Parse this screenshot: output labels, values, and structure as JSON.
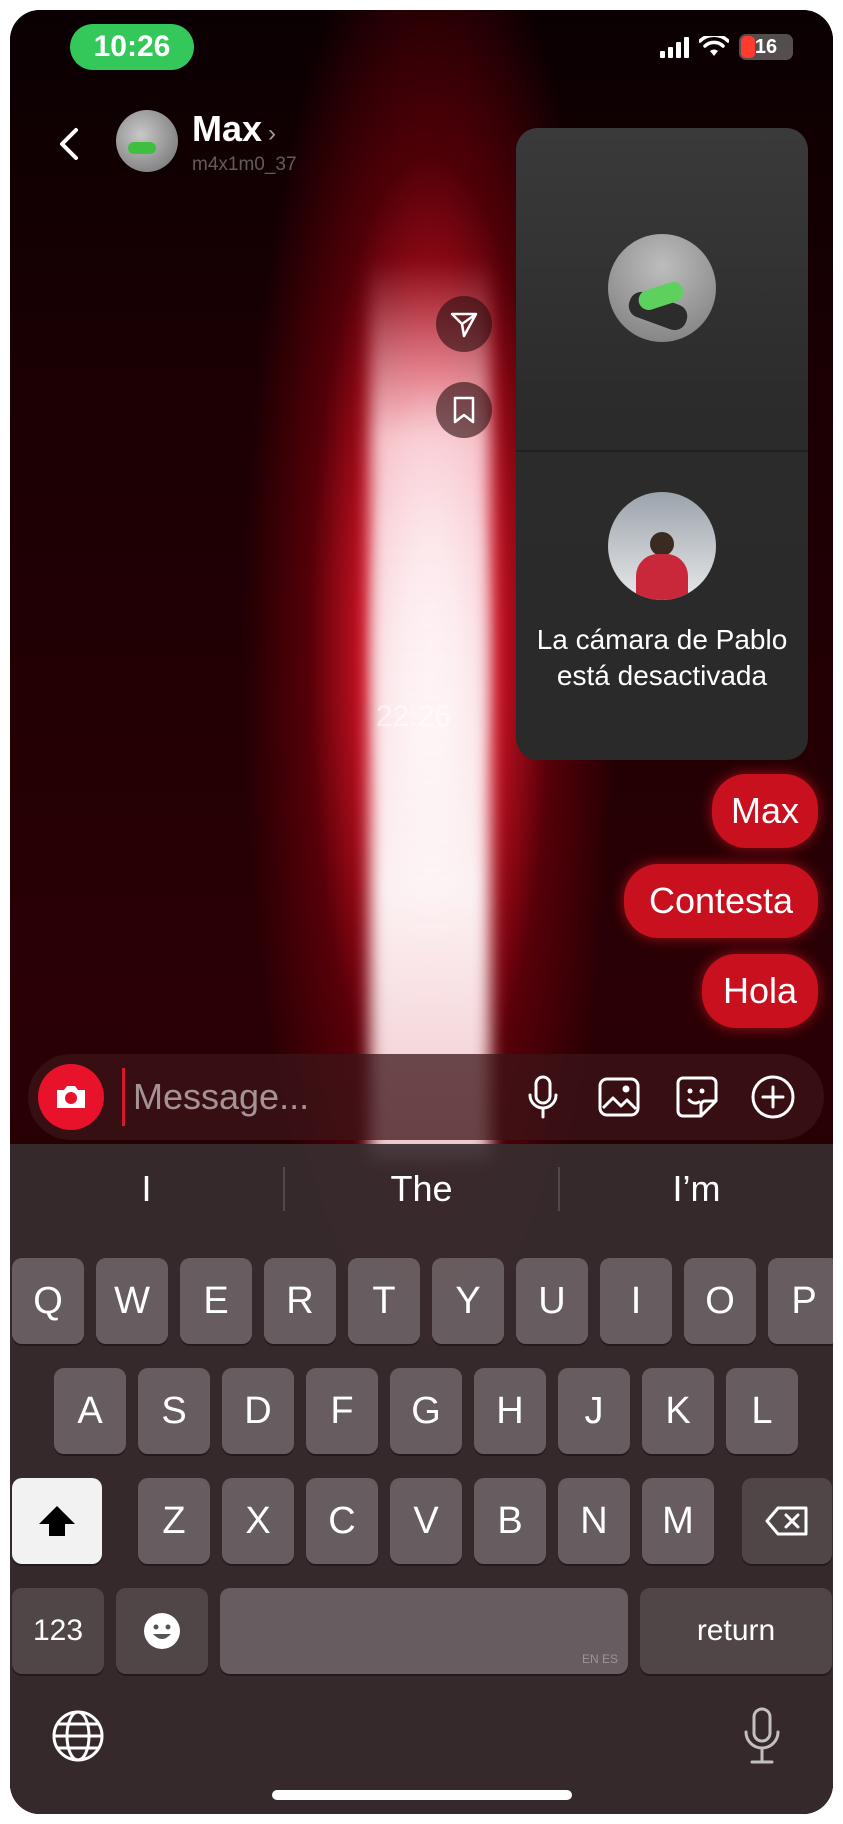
{
  "status_bar": {
    "time": "10:26",
    "battery": "16"
  },
  "header": {
    "contact_name": "Max",
    "username": "m4x1m0_37"
  },
  "chat": {
    "timestamp": "22:26",
    "messages": [
      {
        "text": "Max"
      },
      {
        "text": "Contesta"
      },
      {
        "text": "Hola"
      }
    ]
  },
  "call_panel": {
    "camera_off_text": "La cámara de Pablo está desactivada"
  },
  "composer": {
    "placeholder": "Message..."
  },
  "keyboard": {
    "suggestions": [
      "I",
      "The",
      "I’m"
    ],
    "row1": [
      "Q",
      "W",
      "E",
      "R",
      "T",
      "Y",
      "U",
      "I",
      "O",
      "P"
    ],
    "row2": [
      "A",
      "S",
      "D",
      "F",
      "G",
      "H",
      "J",
      "K",
      "L"
    ],
    "row3": [
      "Z",
      "X",
      "C",
      "V",
      "B",
      "N",
      "M"
    ],
    "numbers_key": "123",
    "return_key": "return",
    "space_hint": "EN ES"
  },
  "colors": {
    "accent": "#c8101e",
    "time_pill": "#34c759"
  }
}
